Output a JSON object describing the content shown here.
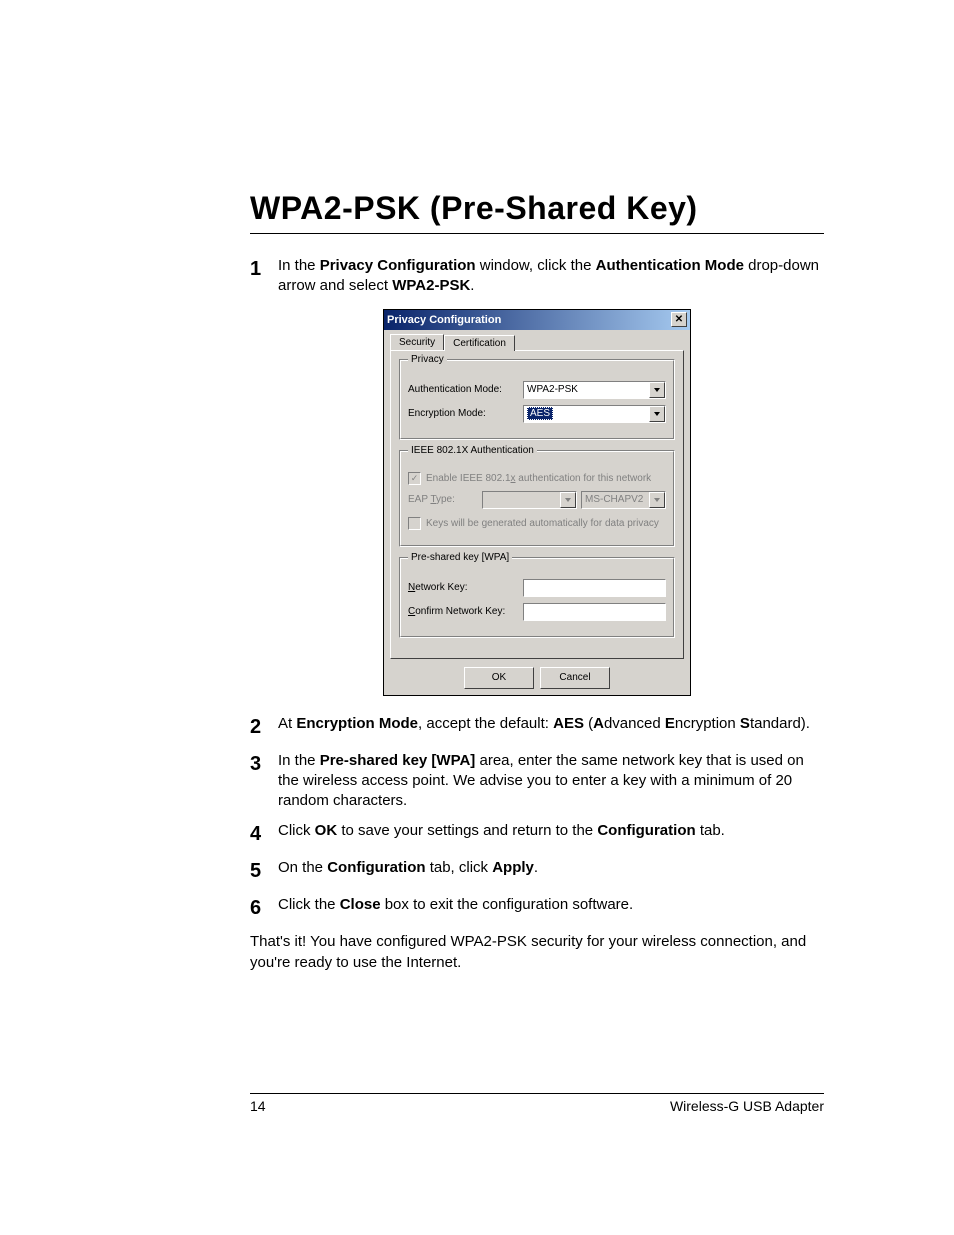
{
  "title": "WPA2-PSK (Pre-Shared Key)",
  "steps": {
    "1": {
      "pre": "In the ",
      "b1": "Privacy Configuration",
      "mid1": " window, click the ",
      "b2": "Authentication Mode",
      "mid2": " drop-down arrow and select ",
      "b3": "WPA2-PSK",
      "end": "."
    },
    "2": {
      "pre": "At ",
      "b1": "Encryption Mode",
      "mid1": ", accept the default: ",
      "b2": "AES",
      "mid2": " (",
      "b3": "A",
      "mid3": "dvanced ",
      "b4": "E",
      "mid4": "ncryption ",
      "b5": "S",
      "mid5": "tandard)."
    },
    "3": {
      "pre": "In the ",
      "b1": "Pre-shared key [WPA]",
      "mid1": " area, enter the same network key that is used on the wireless access point. We advise you to enter a key with a minimum of 20 random characters."
    },
    "4": {
      "pre": "Click ",
      "b1": "OK",
      "mid1": " to save your settings and return to the ",
      "b2": "Configuration",
      "mid2": " tab."
    },
    "5": {
      "pre": "On the ",
      "b1": "Configuration",
      "mid1": " tab, click ",
      "b2": "Apply",
      "mid2": "."
    },
    "6": {
      "pre": "Click the ",
      "b1": "Close",
      "mid1": " box to exit the configuration software."
    }
  },
  "closing": "That's it! You have configured WPA2-PSK security for your wireless connection, and you're ready to use the Internet.",
  "dialog": {
    "title": "Privacy Configuration",
    "tabs": {
      "security": "Security",
      "certification": "Certification"
    },
    "privacy": {
      "legend": "Privacy",
      "auth_label": "Authentication Mode:",
      "auth_value": "WPA2-PSK",
      "enc_label": "Encryption Mode:",
      "enc_value": "AES"
    },
    "ieee": {
      "legend": "IEEE 802.1X Authentication",
      "enable_u": "x",
      "enable_pre": "Enable IEEE 802.1",
      "enable_post": " authentication for this network",
      "eap_u": "T",
      "eap_label": "EAP ",
      "eap_post": "ype:",
      "eap2_value": "MS-CHAPV2",
      "keys_label": "Keys will be generated automatically for data privacy"
    },
    "psk": {
      "legend": "Pre-shared key [WPA]",
      "nk_u": "N",
      "nk_label": "etwork Key:",
      "cnk_u": "C",
      "cnk_label": "onfirm Network Key:"
    },
    "ok": "OK",
    "cancel": "Cancel"
  },
  "footer": {
    "page": "14",
    "product": "Wireless-G USB Adapter"
  }
}
